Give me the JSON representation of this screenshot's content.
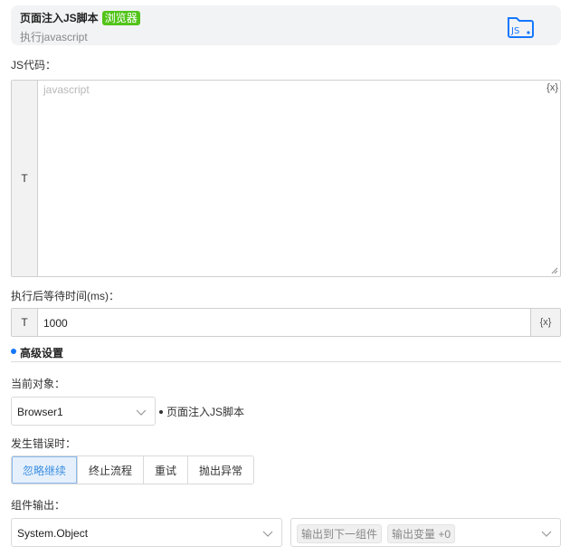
{
  "header": {
    "title": "页面注入JS脚本",
    "tag": "浏览器",
    "subtitle": "执行javascript",
    "icon": "js-folder-icon",
    "accent": "#1677ff",
    "tag_color": "#52c41a"
  },
  "js_code": {
    "label": "JS代码：",
    "prefix": "T",
    "placeholder": "javascript",
    "var_button": "{x}"
  },
  "wait": {
    "label": "执行后等待时间(ms)：",
    "prefix": "T",
    "value": "1000",
    "var_button": "{x}"
  },
  "advanced": {
    "title": "高级设置"
  },
  "current_object": {
    "label": "当前对象：",
    "value": "Browser1",
    "note": "页面注入JS脚本"
  },
  "on_error": {
    "label": "发生错误时：",
    "options": [
      "忽略继续",
      "终止流程",
      "重试",
      "抛出异常"
    ],
    "selected": "忽略继续"
  },
  "output": {
    "label": "组件输出：",
    "value": "System.Object",
    "chip_next": "输出到下一组件",
    "chip_var": "输出变量 +0"
  }
}
